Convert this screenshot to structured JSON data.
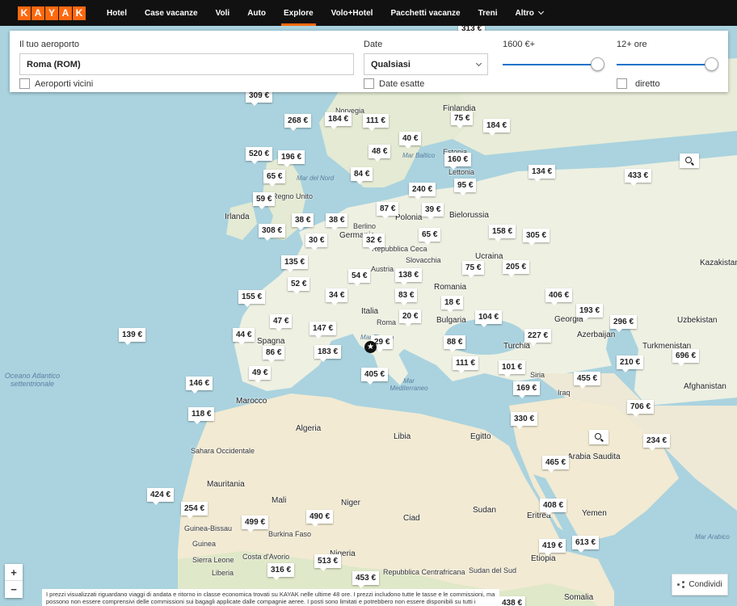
{
  "nav": {
    "logo_letters": [
      "K",
      "A",
      "Y",
      "A",
      "K"
    ],
    "items": [
      "Hotel",
      "Case vacanze",
      "Voli",
      "Auto",
      "Explore",
      "Volo+Hotel",
      "Pacchetti vacanze",
      "Treni",
      "Altro"
    ],
    "active": "Explore"
  },
  "filters": {
    "airport_label": "Il tuo aeroporto",
    "airport_value": "Roma (ROM)",
    "nearby_label": "Aeroporti vicini",
    "date_label": "Date",
    "date_value": "Qualsiasi",
    "exact_dates_label": "Date esatte",
    "price_label": "1600 €+",
    "duration_label": "12+ ore",
    "direct_label": "diretto"
  },
  "map": {
    "origin_marker": "★",
    "prices": [
      "313 €",
      "309 €",
      "268 €",
      "184 €",
      "111 €",
      "75 €",
      "184 €",
      "40 €",
      "520 €",
      "196 €",
      "48 €",
      "160 €",
      "65 €",
      "84 €",
      "95 €",
      "134 €",
      "433 €",
      "59 €",
      "240 €",
      "87 €",
      "39 €",
      "38 €",
      "38 €",
      "308 €",
      "30 €",
      "32 €",
      "65 €",
      "158 €",
      "305 €",
      "135 €",
      "75 €",
      "205 €",
      "52 €",
      "54 €",
      "138 €",
      "155 €",
      "34 €",
      "83 €",
      "406 €",
      "18 €",
      "193 €",
      "47 €",
      "20 €",
      "104 €",
      "296 €",
      "139 €",
      "147 €",
      "44 €",
      "29 €",
      "227 €",
      "86 €",
      "183 €",
      "88 €",
      "210 €",
      "696 €",
      "111 €",
      "101 €",
      "49 €",
      "405 €",
      "455 €",
      "146 €",
      "169 €",
      "706 €",
      "118 €",
      "330 €",
      "234 €",
      "465 €",
      "424 €",
      "254 €",
      "408 €",
      "499 €",
      "490 €",
      "419 €",
      "613 €",
      "513 €",
      "316 €",
      "453 €",
      "438 €"
    ],
    "labels": {
      "finlandia": "Finlandia",
      "norvegia": "Norvegia",
      "estonia": "Estonia",
      "lettonia": "Lettonia",
      "bielorussia": "Bielorussia",
      "polonia": "Polonia",
      "regno_unito": "Regno Unito",
      "irlanda": "Irlanda",
      "germania": "Germania",
      "berlino": "Berlino",
      "repubblica_ceca": "Repubblica Ceca",
      "slovacchia": "Slovacchia",
      "ucraina": "Ucraina",
      "kazakistan": "Kazakistan",
      "austria": "Austria",
      "romania": "Romania",
      "italia": "Italia",
      "roma": "Roma",
      "bulgaria": "Bulgaria",
      "georgia": "Georgia",
      "uzbekistan": "Uzbekistan",
      "azerbaijan": "Azerbaijan",
      "spagna": "Spagna",
      "turchia": "Turchia",
      "turkmenistan": "Turkmenistan",
      "siria": "Siria",
      "iraq": "Iraq",
      "afghanistan": "Afghanistan",
      "marocco": "Marocco",
      "algeria": "Algeria",
      "libia": "Libia",
      "egitto": "Egitto",
      "arabia_saudita": "Arabia Saudita",
      "sahara": "Sahara Occidentale",
      "mauritania": "Mauritania",
      "mali": "Mali",
      "niger": "Niger",
      "ciad": "Ciad",
      "sudan": "Sudan",
      "eritrea": "Eritrea",
      "yemen": "Yemen",
      "burkina": "Burkina Faso",
      "guinea": "Guinea",
      "guinea_bissau": "Guinea-Bissau",
      "sierra_leone": "Sierra Leone",
      "liberia": "Liberia",
      "costa": "Costa d'Avorio",
      "nigeria": "Nigeria",
      "sud_sudan": "Sudan del Sud",
      "rep_centr": "Repubblica Centrafricana",
      "etiopia": "Etiopia",
      "somalia": "Somalia",
      "mar_baltico": "Mar Baltico",
      "mar_del_nord": "Mar del Nord",
      "mar_tirreno": "Mar Tirreno",
      "mar_mediterraneo": "Mar Mediterraneo",
      "mar_arabico": "Mar Arabico",
      "oceano": "Oceano Atlantico settentrionale"
    }
  },
  "disclaimer": "I prezzi visualizzati riguardano viaggi di andata e ritorno in classe economica trovati su KAYAK nelle ultime 48 ore. I prezzi includono tutte le tasse e le commissioni, ma possono non essere comprensivi delle commissioni sui bagagli applicate dalle compagnie aeree. I posti sono limitati e potrebbero non essere disponibili su tutti i",
  "share_label": "Condividi",
  "zoom": {
    "in": "+",
    "out": "−"
  },
  "colors": {
    "accent": "#ff690f",
    "nav_bg": "#111111",
    "slider": "#1a73c9",
    "sea": "#aad3df",
    "land": "#f2efe6"
  }
}
